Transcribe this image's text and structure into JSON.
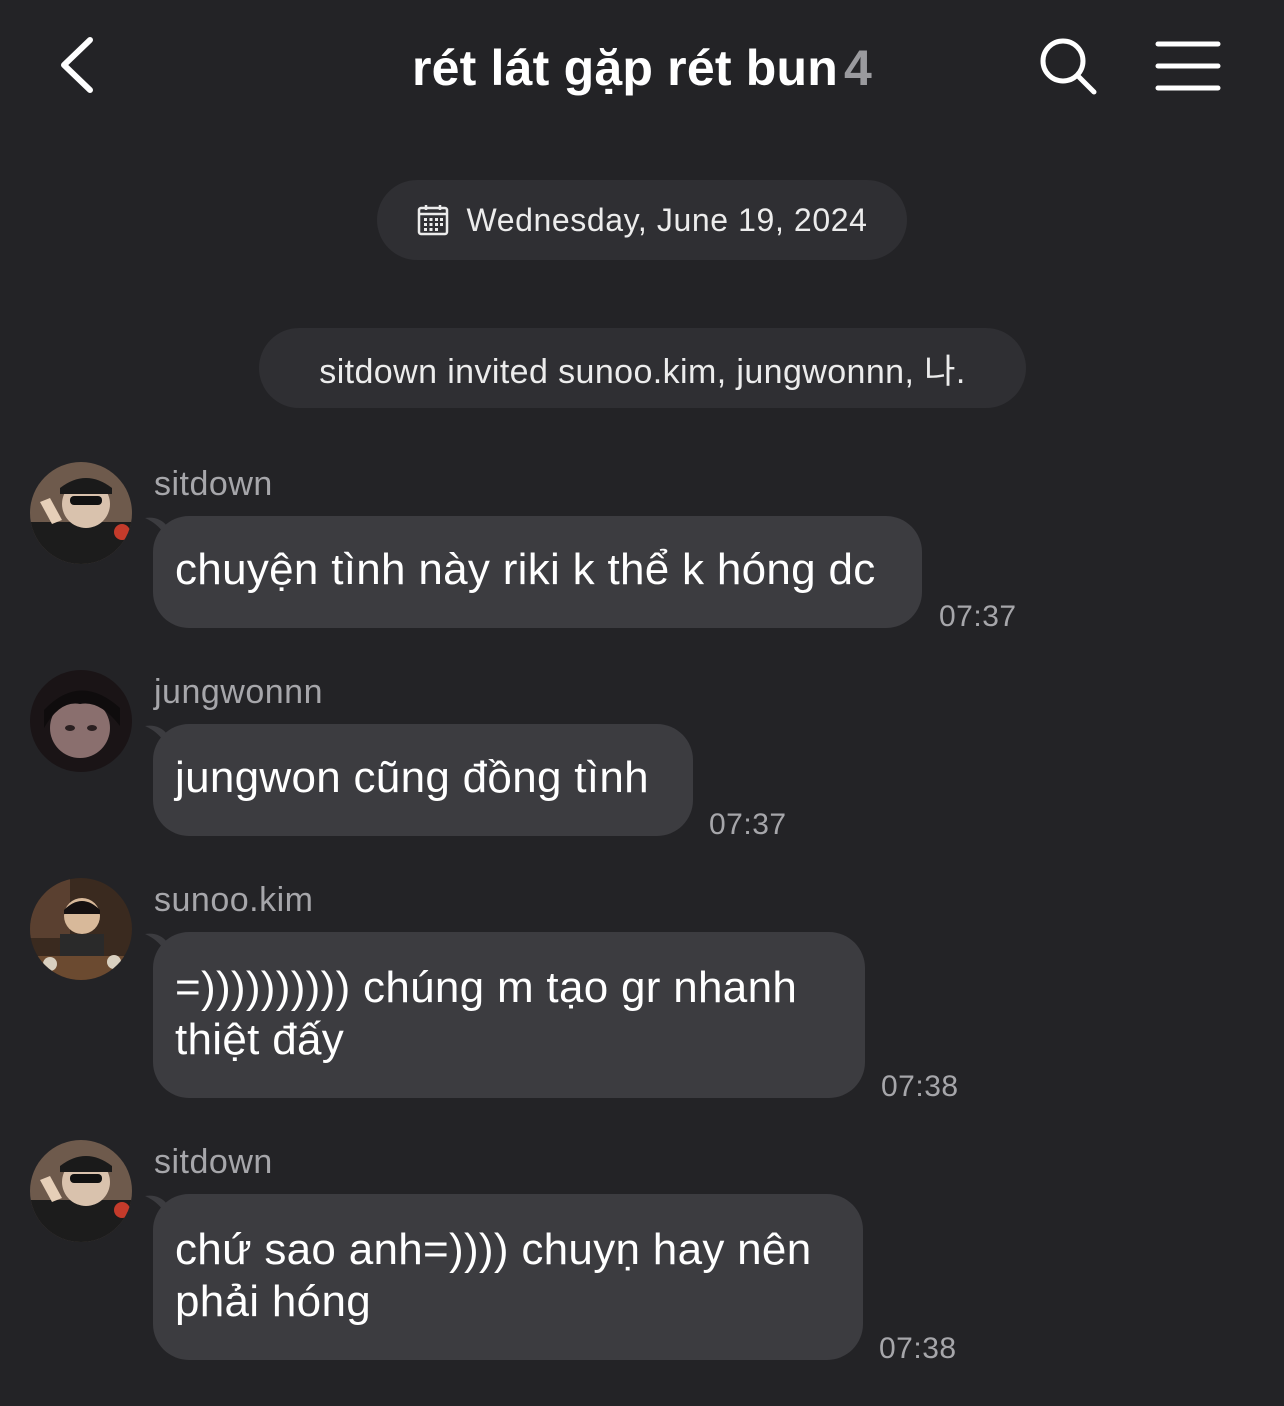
{
  "header": {
    "title": "rét lát gặp rét bun",
    "member_count": "4"
  },
  "date_divider": {
    "label": "Wednesday, June 19, 2024"
  },
  "system_message": {
    "text": "sitdown invited sunoo.kim, jungwonnn, 나."
  },
  "messages": [
    {
      "sender": "sitdown",
      "text": "chuyện tình này riki k thể k hóng dc",
      "time": "07:37"
    },
    {
      "sender": "jungwonnn",
      "text": "jungwon cũng đồng tình",
      "time": "07:37"
    },
    {
      "sender": "sunoo.kim",
      "text_line1": "=)))))))))) chúng m tạo gr nhanh",
      "text_line2": "thiệt đấy",
      "time": "07:38"
    },
    {
      "sender": "sitdown",
      "text_line1": "chứ sao anh=)))) chuyṇ hay nên",
      "text_line2": "phải hóng",
      "time": "07:38"
    }
  ],
  "colors": {
    "background": "#232326",
    "bubble": "#3c3c40",
    "pill": "#2f2f33",
    "muted_text": "#a6a6aa"
  }
}
